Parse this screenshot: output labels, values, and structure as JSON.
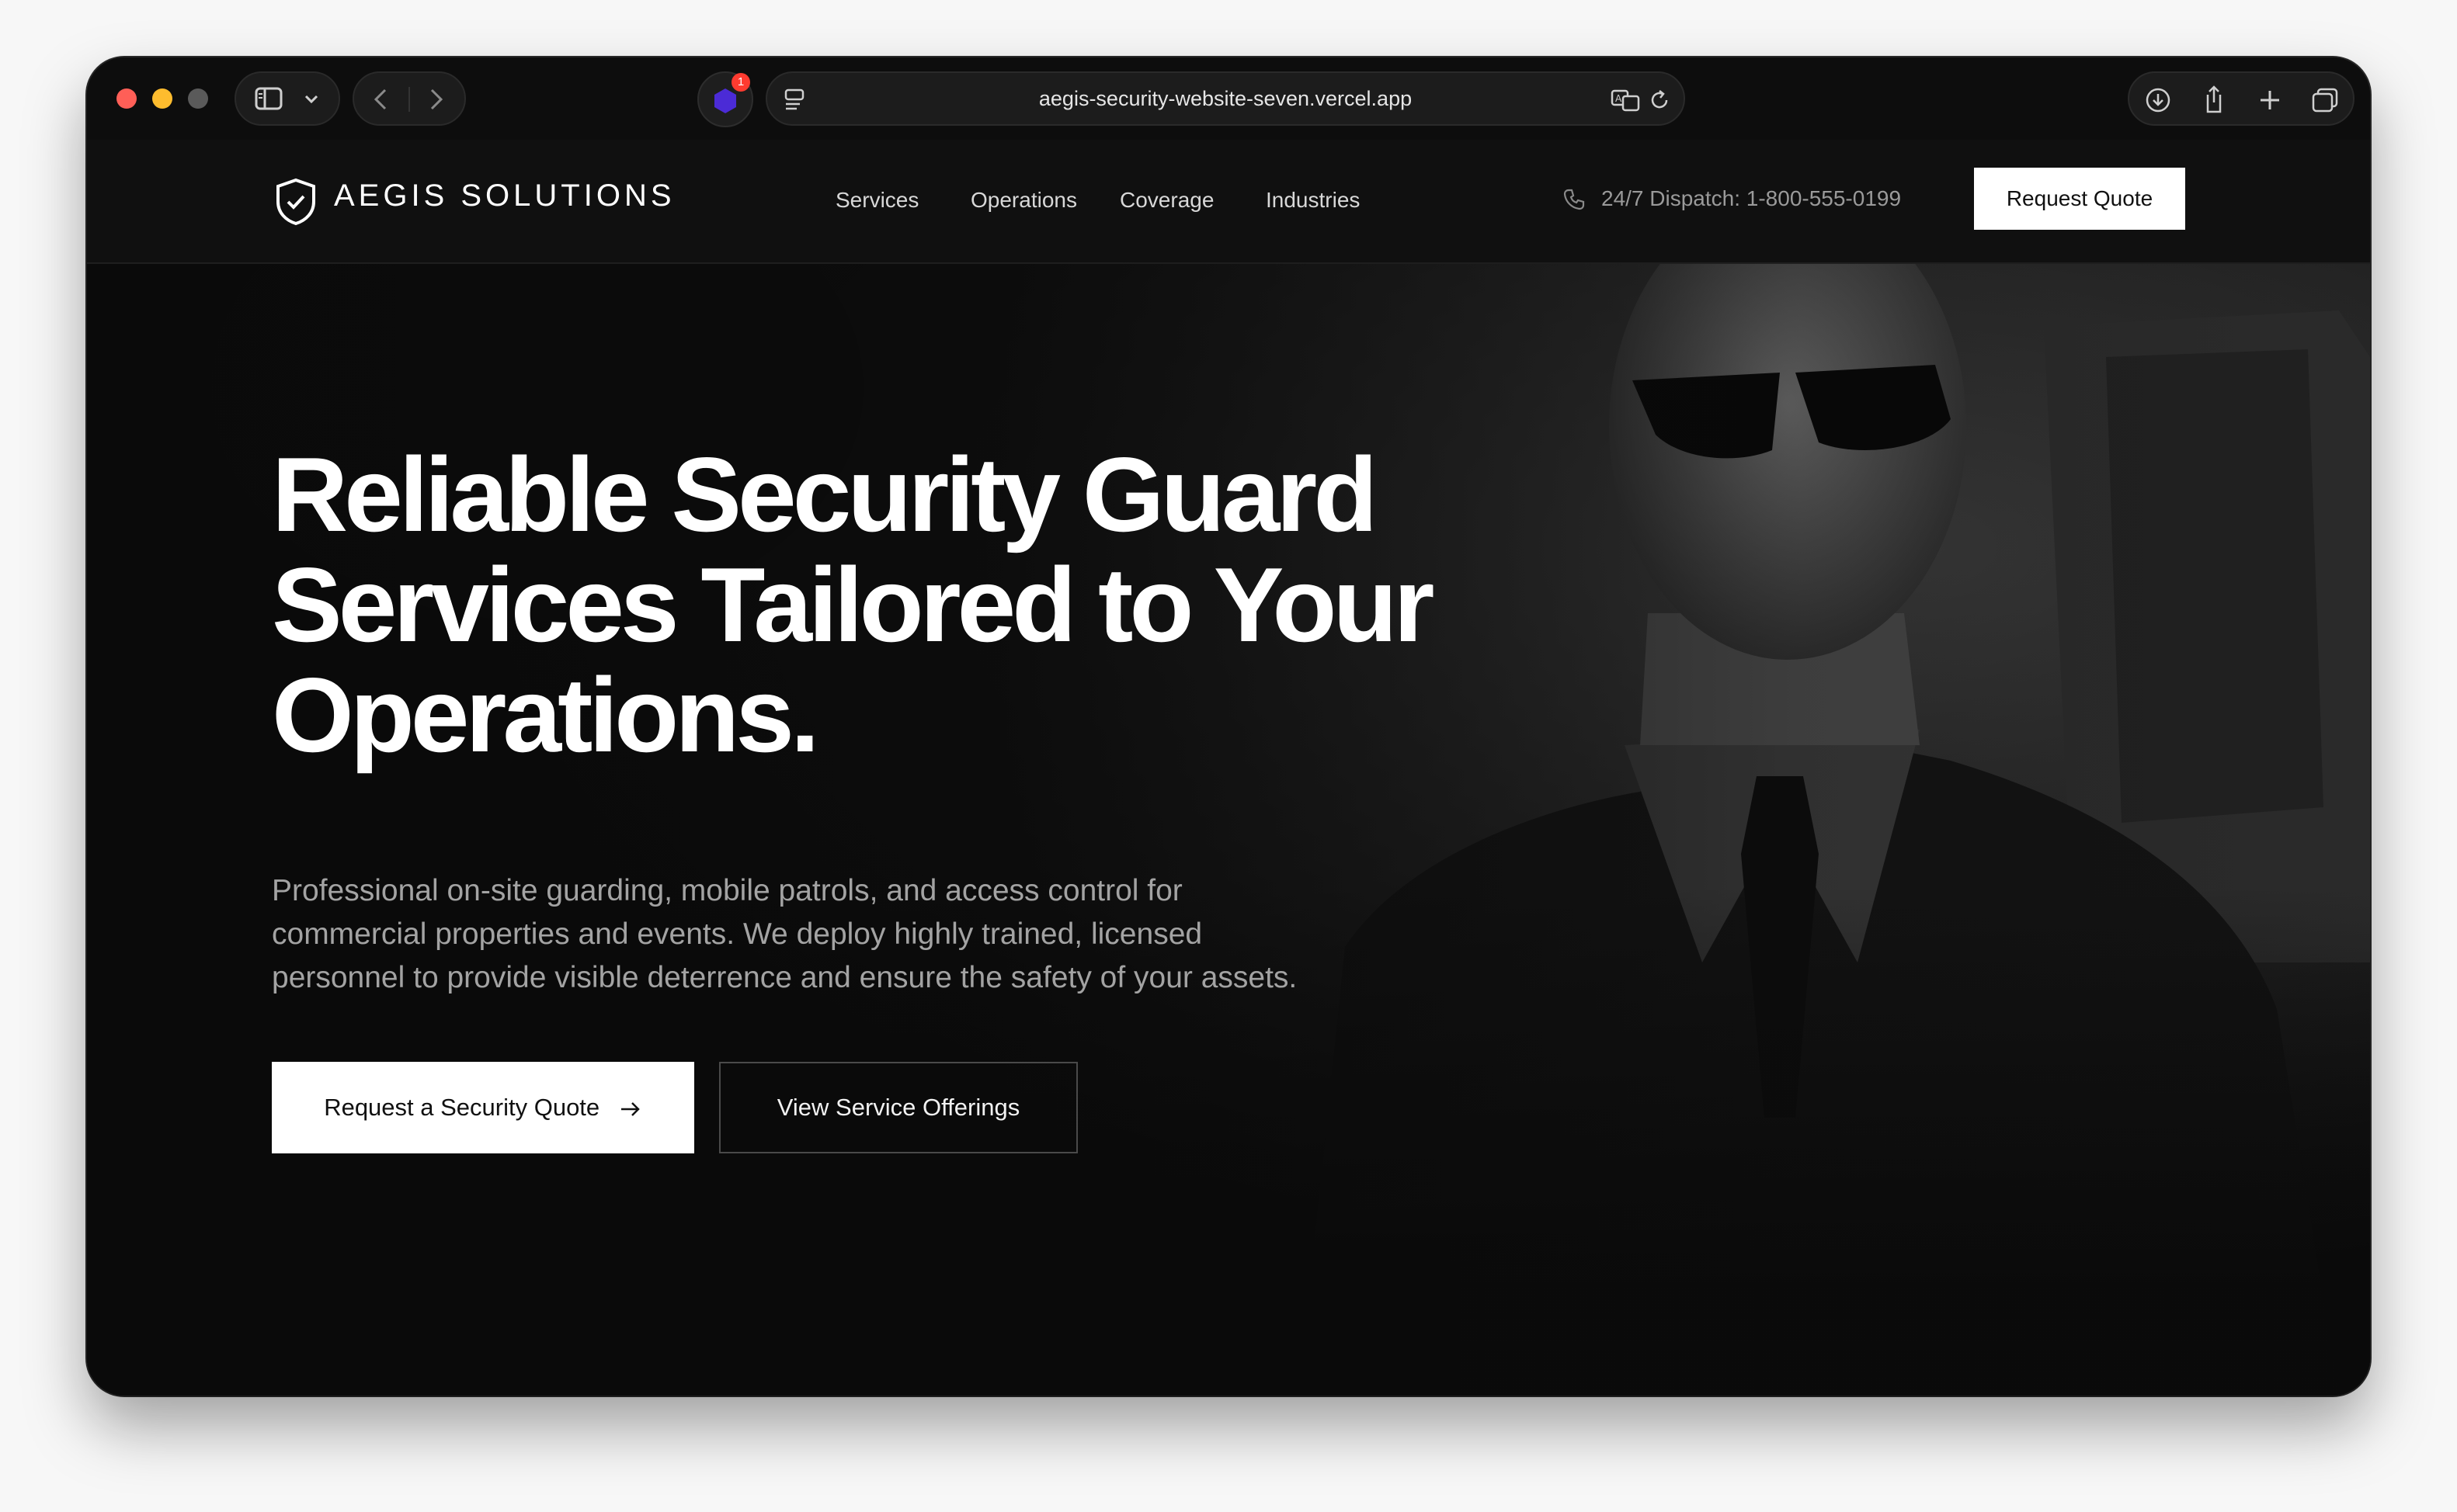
{
  "browser": {
    "url": "aegis-security-website-seven.vercel.app",
    "extension_badge": "1"
  },
  "header": {
    "brand": "AEGIS SOLUTIONS",
    "nav": [
      "Services",
      "Operations",
      "Coverage",
      "Industries"
    ],
    "dispatch": "24/7 Dispatch: 1-800-555-0199",
    "cta": "Request Quote"
  },
  "hero": {
    "headline": "Reliable Security Guard Services Tailored to Your Operations.",
    "subtext": "Professional on-site guarding, mobile patrols, and access control for commercial properties and events. We deploy highly trained, licensed personnel to provide visible deterrence and ensure the safety of your assets.",
    "primary_cta": "Request a Security Quote",
    "secondary_cta": "View Service Offerings"
  },
  "icons": {
    "brand": "shield-check-icon",
    "phone": "phone-icon",
    "arrow": "arrow-right-icon"
  },
  "colors": {
    "background": "#0c0c0c",
    "text": "#ffffff",
    "muted": "#a3a3a3",
    "accent": "#ffffff"
  }
}
